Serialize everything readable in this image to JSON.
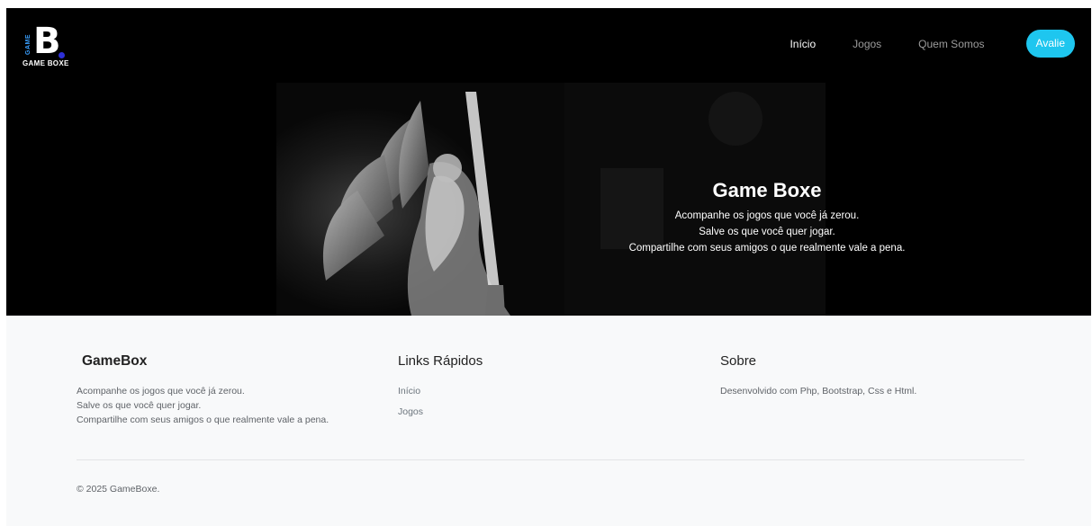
{
  "brand": {
    "logo_tag": "GAME",
    "logo_letter": "B",
    "logo_name": "GAME BOXE",
    "accent_color": "#1ec6ef"
  },
  "nav": {
    "items": [
      {
        "label": "Início",
        "active": true
      },
      {
        "label": "Jogos",
        "active": false
      },
      {
        "label": "Quem Somos",
        "active": false
      }
    ],
    "cta_label": "Avalie"
  },
  "hero": {
    "title": "Game Boxe",
    "lines": [
      "Acompanhe os jogos que você já zerou.",
      "Salve os que você quer jogar.",
      "Compartilhe com seus amigos o que realmente vale a pena."
    ],
    "image": "dark-armored-angel-warrior"
  },
  "footer": {
    "about_col": {
      "title": "GameBox",
      "lines": [
        "Acompanhe os jogos que você já zerou.",
        "Salve os que você quer jogar.",
        "Compartilhe com seus amigos o que realmente vale a pena."
      ]
    },
    "links_col": {
      "title": "Links Rápidos",
      "links": [
        "Início",
        "Jogos"
      ]
    },
    "sobre_col": {
      "title": "Sobre",
      "text": "Desenvolvido com Php, Bootstrap, Css e Html."
    },
    "copyright": "© 2025 GameBoxe."
  }
}
